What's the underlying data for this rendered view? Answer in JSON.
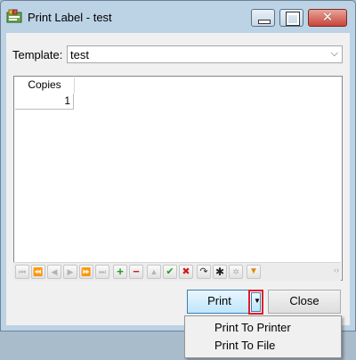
{
  "window": {
    "title": "Print Label - test"
  },
  "template": {
    "label": "Template:",
    "value": "test"
  },
  "grid": {
    "columns": [
      "Copies"
    ],
    "rows": [
      [
        "1"
      ]
    ]
  },
  "navigator": {
    "buttons": [
      "first",
      "prior-page",
      "prior",
      "next",
      "next-page",
      "last",
      "insert",
      "delete",
      "edit",
      "post",
      "cancel",
      "refresh",
      "save-bookmark",
      "goto-bookmark",
      "filter"
    ]
  },
  "buttons": {
    "print": "Print",
    "close": "Close"
  },
  "print_menu": {
    "items": [
      "Print To Printer",
      "Print To File"
    ]
  },
  "colors": {
    "split_highlight": "#e21c2a",
    "print_button_border": "#3c7fb1"
  }
}
